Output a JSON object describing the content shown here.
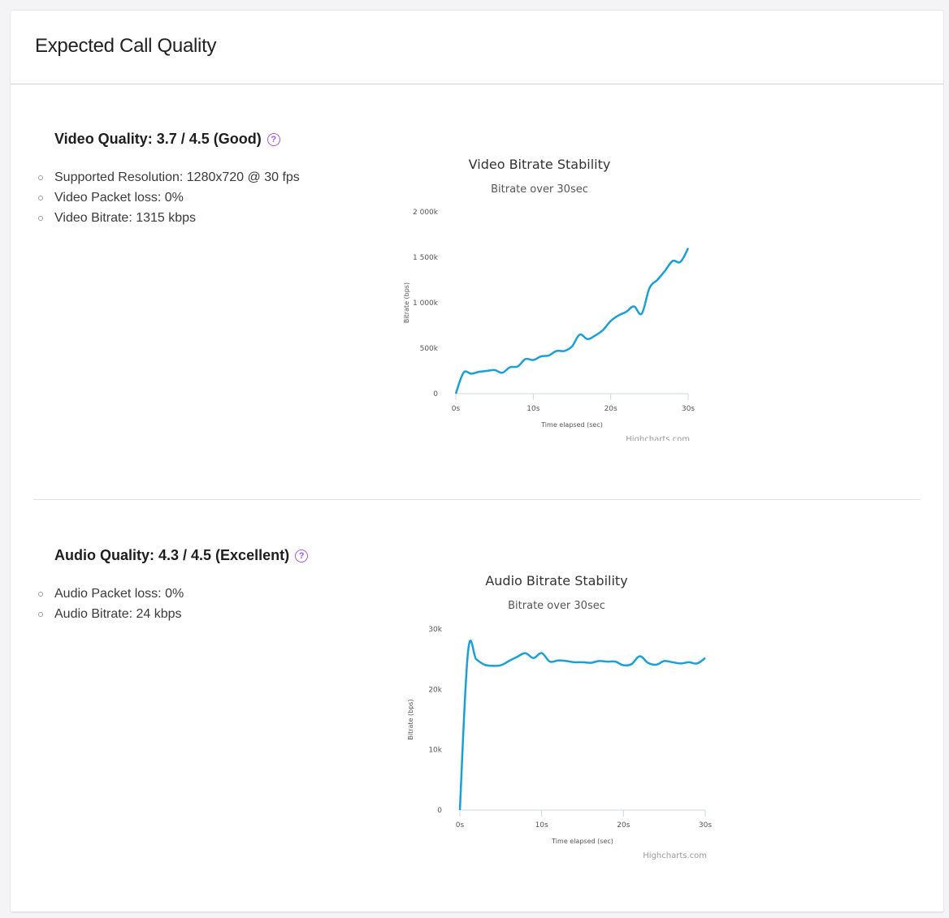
{
  "page": {
    "title": "Expected Call Quality"
  },
  "video": {
    "heading": "Video Quality: 3.7 / 4.5 (Good)",
    "help_icon": "question-circle-icon",
    "metrics": [
      "Supported Resolution: 1280x720 @ 30 fps",
      "Video Packet loss: 0%",
      "Video Bitrate: 1315 kbps"
    ]
  },
  "audio": {
    "heading": "Audio Quality: 4.3 / 4.5 (Excellent)",
    "help_icon": "question-circle-icon",
    "metrics": [
      "Audio Packet loss: 0%",
      "Audio Bitrate: 24 kbps"
    ]
  },
  "colors": {
    "line": "#1a9fd6",
    "help_icon": "#a259e8"
  },
  "chart_data": [
    {
      "type": "line",
      "title": "Video Bitrate Stability",
      "subtitle": "Bitrate over 30sec",
      "xlabel": "Time elapsed (sec)",
      "ylabel": "Bitrate (bps)",
      "credit": "Highcharts.com",
      "xlim": [
        0,
        30
      ],
      "ylim": [
        0,
        2000000
      ],
      "x_ticks": [
        0,
        10,
        20,
        30
      ],
      "x_tick_labels": [
        "0s",
        "10s",
        "20s",
        "30s"
      ],
      "y_ticks": [
        0,
        500000,
        1000000,
        1500000,
        2000000
      ],
      "y_tick_labels": [
        "0",
        "500k",
        "1 000k",
        "1 500k",
        "2 000k"
      ],
      "series": [
        {
          "x": [
            0,
            1,
            2,
            3,
            4,
            5,
            6,
            7,
            8,
            9,
            10,
            11,
            12,
            13,
            14,
            15,
            16,
            17,
            18,
            19,
            20,
            21,
            22,
            23,
            24,
            25,
            26,
            27,
            28,
            29,
            30
          ],
          "values": [
            0,
            230000,
            220000,
            240000,
            250000,
            260000,
            230000,
            290000,
            300000,
            380000,
            370000,
            410000,
            420000,
            470000,
            470000,
            520000,
            650000,
            600000,
            640000,
            700000,
            800000,
            860000,
            900000,
            960000,
            880000,
            1160000,
            1250000,
            1350000,
            1460000,
            1450000,
            1600000
          ]
        }
      ]
    },
    {
      "type": "line",
      "title": "Audio Bitrate Stability",
      "subtitle": "Bitrate over 30sec",
      "xlabel": "Time elapsed (sec)",
      "ylabel": "Bitrate (bps)",
      "credit": "Highcharts.com",
      "xlim": [
        0,
        30
      ],
      "ylim": [
        0,
        30000
      ],
      "x_ticks": [
        0,
        10,
        20,
        30
      ],
      "x_tick_labels": [
        "0s",
        "10s",
        "20s",
        "30s"
      ],
      "y_ticks": [
        0,
        10000,
        20000,
        30000
      ],
      "y_tick_labels": [
        "0",
        "10k",
        "20k",
        "30k"
      ],
      "series": [
        {
          "x": [
            0,
            1,
            2,
            3,
            4,
            5,
            6,
            7,
            8,
            9,
            10,
            11,
            12,
            13,
            14,
            15,
            16,
            17,
            18,
            19,
            20,
            21,
            22,
            23,
            24,
            25,
            26,
            27,
            28,
            29,
            30
          ],
          "values": [
            0,
            26300,
            25000,
            24100,
            23900,
            24000,
            24700,
            25400,
            26000,
            25200,
            26000,
            24600,
            24800,
            24700,
            24500,
            24500,
            24400,
            24700,
            24600,
            24600,
            24000,
            24200,
            25500,
            24400,
            24100,
            24700,
            24500,
            24300,
            24500,
            24300,
            25200
          ]
        }
      ]
    }
  ]
}
